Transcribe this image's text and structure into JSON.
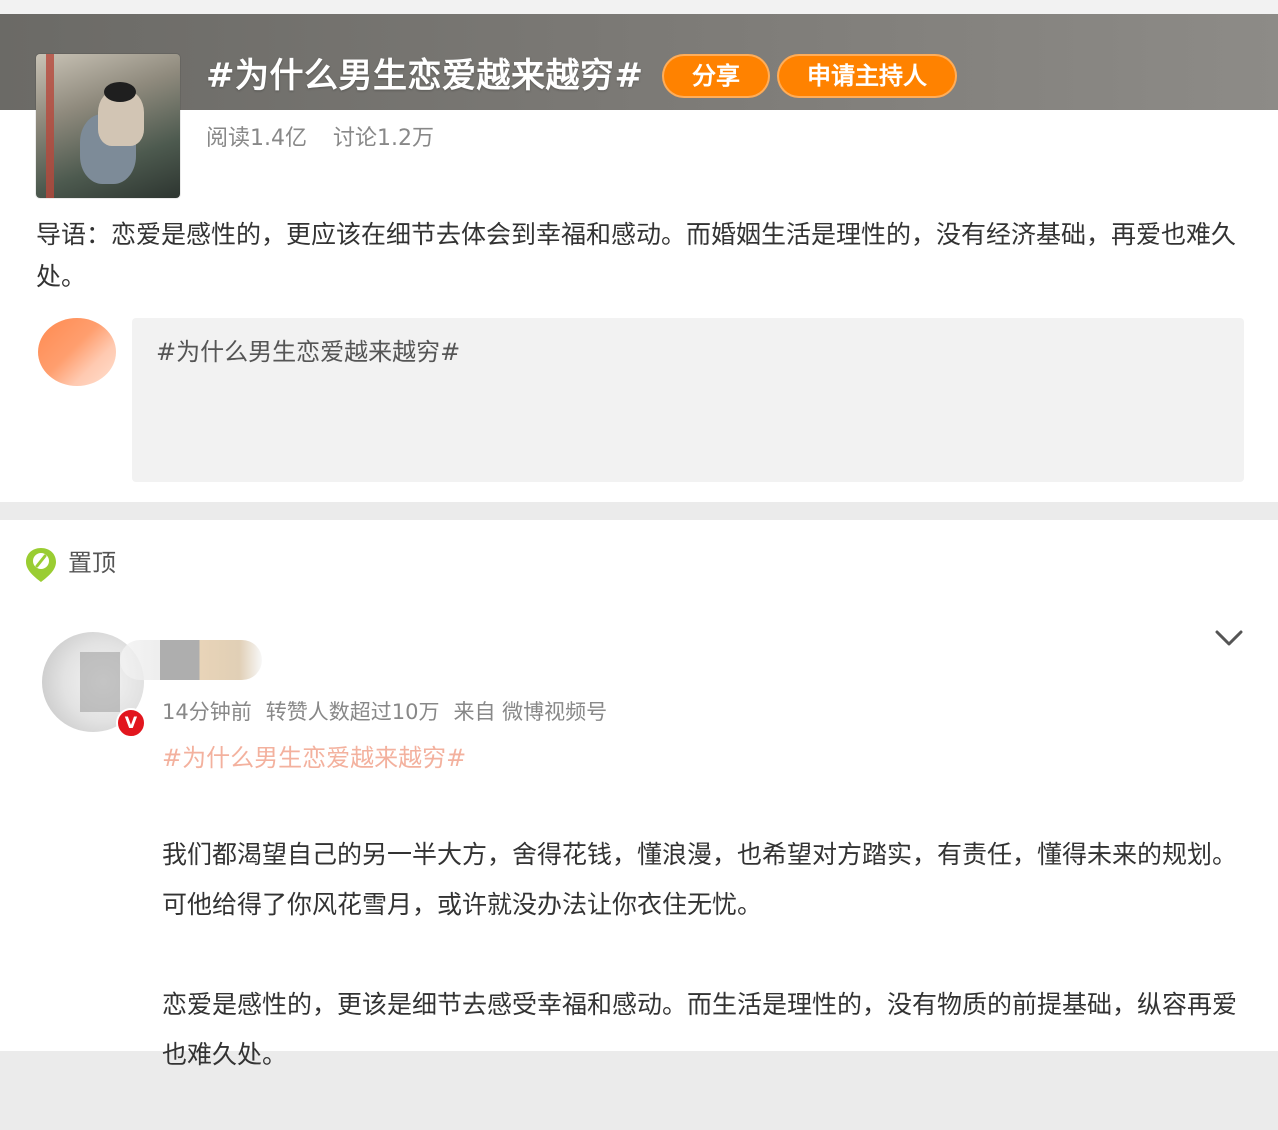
{
  "topic": {
    "title": "#为什么男生恋爱越来越穷#",
    "share_label": "分享",
    "host_label": "申请主持人",
    "reads": "阅读1.4亿",
    "discussions": "讨论1.2万",
    "intro": "导语：恋爱是感性的，更应该在细节去体会到幸福和感动。而婚姻生活是理性的，没有经济基础，再爱也难久处。"
  },
  "compose": {
    "text": "#为什么男生恋爱越来越穷#"
  },
  "pinned": {
    "label": "置顶"
  },
  "post": {
    "verified_mark": "V",
    "time": "14分钟前",
    "repost_note": "转赞人数超过10万",
    "source": "来自 微博视频号",
    "topic_tag": "#为什么男生恋爱越来越穷#",
    "paragraphs": [
      "我们都渴望自己的另一半大方，舍得花钱，懂浪漫，也希望对方踏实，有责任，懂得未来的规划。可他给得了你风花雪月，或许就没办法让你衣住无忧。",
      "恋爱是感性的，更该是细节去感受幸福和感动。而生活是理性的，没有物质的前提基础，纵容再爱也难久处。"
    ]
  },
  "colors": {
    "accent_orange": "#ff8200",
    "topic_link": "#eb7350",
    "verified_red": "#e2161e",
    "pin_green": "#9acd32"
  }
}
